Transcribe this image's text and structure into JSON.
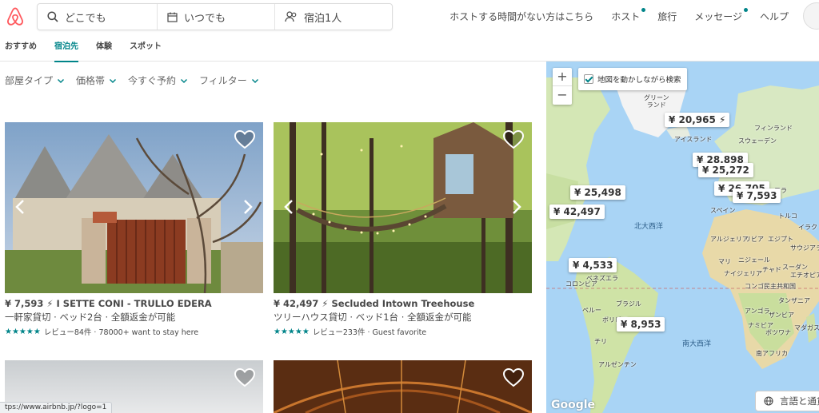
{
  "header": {
    "search": {
      "where": "どこでも",
      "when": "いつでも",
      "guests": "宿泊1人"
    },
    "nav": {
      "host_promo": "ホストする時間がない方はこちら",
      "host": "ホスト",
      "trips": "旅行",
      "messages": "メッセージ",
      "help": "ヘルプ"
    },
    "brand_color": "#FF5A5F",
    "accent_color": "#008489"
  },
  "tabs": [
    {
      "label": "おすすめ",
      "active": false
    },
    {
      "label": "宿泊先",
      "active": true
    },
    {
      "label": "体験",
      "active": false
    },
    {
      "label": "スポット",
      "active": false
    }
  ],
  "filters": [
    "部屋タイプ",
    "価格帯",
    "今すぐ予約",
    "フィルター"
  ],
  "listings": [
    {
      "price": "¥ 7,593",
      "name": "I SETTE CONI - TRULLO EDERA",
      "details": "一軒家貸切 · ベッド2台 · 全額返金が可能",
      "reviews": "レビュー84件 · 78000+ want to stay here",
      "stars": "★★★★★"
    },
    {
      "price": "¥ 42,497",
      "name": "Secluded Intown Treehouse",
      "details": "ツリーハウス貸切 · ベッド1台 · 全額返金が可能",
      "reviews": "レビュー233件 · Guest favorite",
      "stars": "★★★★★"
    }
  ],
  "status_url": "tps://www.airbnb.jp/?logo=1",
  "map": {
    "toggle_label": "地図を動かしながら検索",
    "zoom_in": "+",
    "zoom_out": "−",
    "pins": [
      "¥ 20,965",
      "¥ 28,898",
      "¥ 25,272",
      "¥ 25,498",
      "¥ 42,497",
      "¥ 7,593",
      "¥ 4,533",
      "¥ 8,953",
      "¥ 26,705"
    ],
    "labels": {
      "greenland": "グリーン\nランド",
      "iceland": "アイスランド",
      "finland": "フィンランド",
      "sweden": "スウェーデン",
      "north_atlantic": "北大西洋",
      "south_atlantic": "南大西洋",
      "spain": "スペイン",
      "france": "フラ",
      "turkey": "トルコ",
      "iraq": "イラク",
      "algeria": "アルジェリア",
      "libya": "リビア",
      "egypt": "エジプト",
      "saudi": "サウジアラビ",
      "mali": "マリ",
      "niger": "ニジェール",
      "chad": "チャド",
      "sudan": "スーダン",
      "nigeria": "ナイジェリア",
      "ethiopia": "エチオピア",
      "colombia": "コロンビア",
      "venezuela": "ベネズエラ",
      "peru": "ペルー",
      "brazil": "ブラジル",
      "bolivia": "ボリビア",
      "chile": "チリ",
      "argentina": "アルゼンチン",
      "congo": "コンゴ民主共和国",
      "tanzania": "タンザニア",
      "angola": "アンゴラ",
      "zambia": "ザンビア",
      "namibia": "ナミビア",
      "botswana": "ボツワナ",
      "madagascar": "マダガスカ",
      "south_africa": "南アフリカ"
    },
    "google": "Google",
    "language_button": "言語と通貨"
  }
}
